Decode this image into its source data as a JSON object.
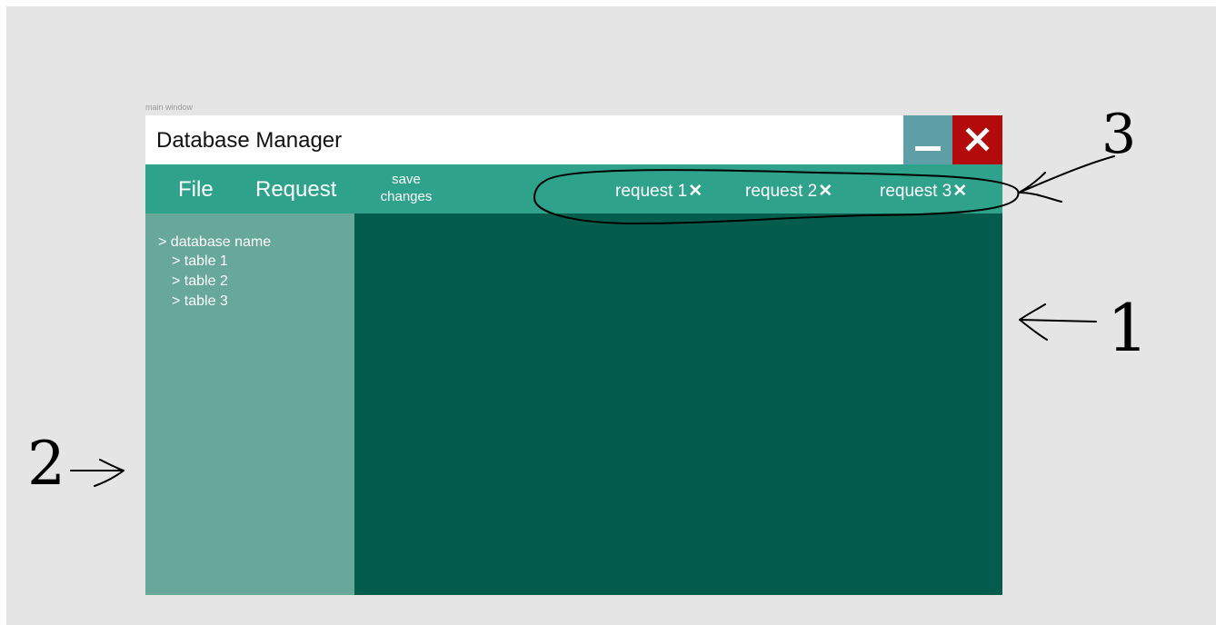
{
  "frame": {
    "label": "main window"
  },
  "window": {
    "title": "Database Manager",
    "minimize_icon": "minimize-icon",
    "close_icon": "close-icon",
    "colors": {
      "titlebar": "#ffffff",
      "minimize": "#5e9fa8",
      "close": "#b30b0b",
      "menubar": "#2fa28b",
      "sidebar": "#67a89a",
      "content": "#045d4c"
    }
  },
  "menu": {
    "file": "File",
    "request": "Request",
    "save_line1": "save",
    "save_line2": "changes"
  },
  "tabs": [
    {
      "label": "request 1",
      "close": "✕"
    },
    {
      "label": "request 2",
      "close": "✕"
    },
    {
      "label": "request 3",
      "close": "✕"
    }
  ],
  "tree": {
    "database": "> database name",
    "tables": [
      "> table 1",
      "> table 2",
      "> table 3"
    ]
  },
  "annotations": {
    "one": "1",
    "two": "2",
    "three": "3"
  }
}
